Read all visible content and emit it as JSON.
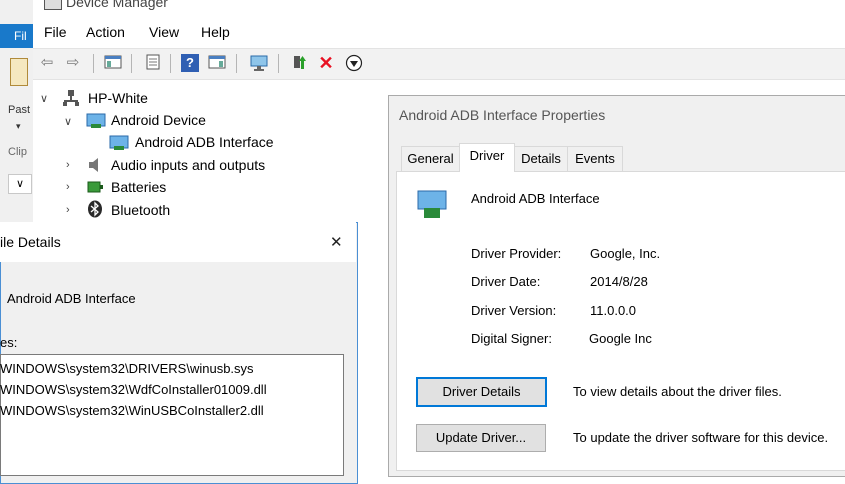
{
  "explorer": {
    "file_tab": "Fil",
    "paste": "Past",
    "clip": "Clip",
    "chevron": "∨"
  },
  "device_manager": {
    "title": "Device Manager",
    "menu": [
      "File",
      "Action",
      "View",
      "Help"
    ],
    "tree": {
      "root": "HP-White",
      "items": [
        {
          "label": "Android Device",
          "expanded": true
        },
        {
          "label": "Android ADB Interface",
          "child": true
        },
        {
          "label": "Audio inputs and outputs"
        },
        {
          "label": "Batteries"
        },
        {
          "label": "Bluetooth"
        }
      ]
    }
  },
  "properties": {
    "title": "Android ADB Interface Properties",
    "tabs": [
      "General",
      "Driver",
      "Details",
      "Events"
    ],
    "active_tab": "Driver",
    "device_name": "Android ADB Interface",
    "fields": [
      {
        "label": "Driver Provider:",
        "value": "Google, Inc."
      },
      {
        "label": "Driver Date:",
        "value": "2014/8/28"
      },
      {
        "label": "Driver Version:",
        "value": "11.0.0.0"
      },
      {
        "label": "Digital Signer:",
        "value": "Google Inc"
      }
    ],
    "buttons": [
      {
        "label": "Driver Details",
        "desc": "To view details about the driver files."
      },
      {
        "label": "Update Driver...",
        "desc": "To update the driver software for this device."
      }
    ]
  },
  "file_details": {
    "title": "ile Details",
    "close": "✕",
    "device_name": "Android ADB Interface",
    "files_label": "es:",
    "files": [
      "WINDOWS\\system32\\DRIVERS\\winusb.sys",
      "WINDOWS\\system32\\WdfCoInstaller01009.dll",
      "WINDOWS\\system32\\WinUSBCoInstaller2.dll"
    ]
  },
  "colors": {
    "accent": "#0078d7",
    "file_tab": "#1979ca"
  }
}
